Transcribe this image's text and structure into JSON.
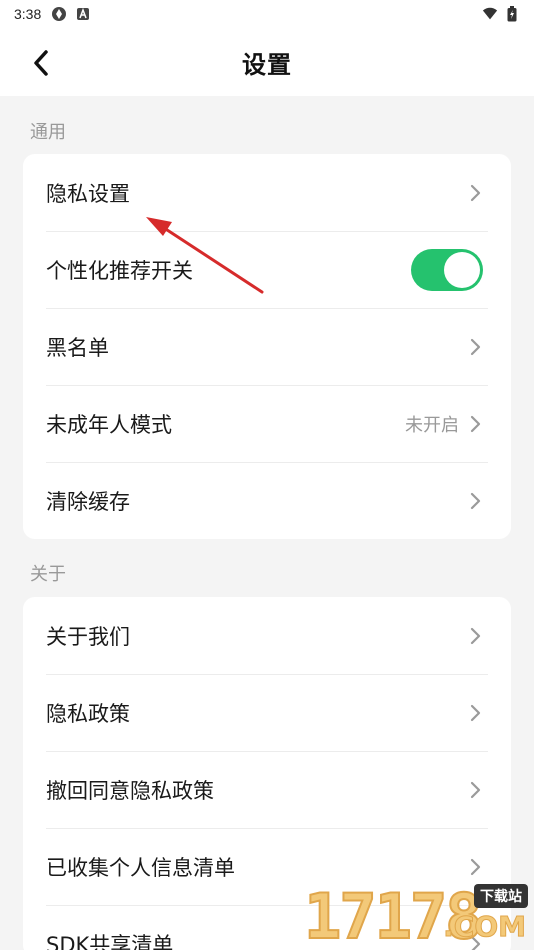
{
  "status_bar": {
    "time": "3:38",
    "left_icons": [
      "app-icon-1",
      "app-icon-2"
    ],
    "right_icons": [
      "wifi-icon",
      "battery-icon"
    ]
  },
  "header": {
    "title": "设置"
  },
  "sections": {
    "general": {
      "label": "通用",
      "items": [
        {
          "label": "隐私设置"
        },
        {
          "label": "个性化推荐开关",
          "toggle_on": true
        },
        {
          "label": "黑名单"
        },
        {
          "label": "未成年人模式",
          "value": "未开启"
        },
        {
          "label": "清除缓存"
        }
      ]
    },
    "about": {
      "label": "关于",
      "items": [
        {
          "label": "关于我们"
        },
        {
          "label": "隐私政策"
        },
        {
          "label": "撤回同意隐私政策"
        },
        {
          "label": "已收集个人信息清单"
        },
        {
          "label": "SDK共享清单"
        }
      ]
    }
  },
  "watermark": {
    "digits": "17178",
    "tag": "下载站",
    "suffix": ".COM"
  },
  "colors": {
    "accent_green": "#25c26e",
    "annotation_red": "#d62b2b",
    "muted_text": "#999999"
  }
}
